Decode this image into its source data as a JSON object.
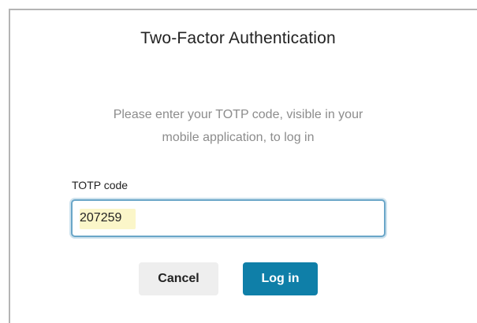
{
  "dialog": {
    "title": "Two-Factor Authentication",
    "description_line1": "Please enter your TOTP code, visible in your",
    "description_line2": "mobile application, to log in"
  },
  "form": {
    "totp_label": "TOTP code",
    "totp_value": "207259"
  },
  "buttons": {
    "cancel_label": "Cancel",
    "login_label": "Log in"
  },
  "colors": {
    "primary": "#0f7fa8",
    "input_focus_border": "#6aa6c8",
    "secondary_button": "#eeeeee",
    "autofill_highlight": "#fbf6c9"
  }
}
